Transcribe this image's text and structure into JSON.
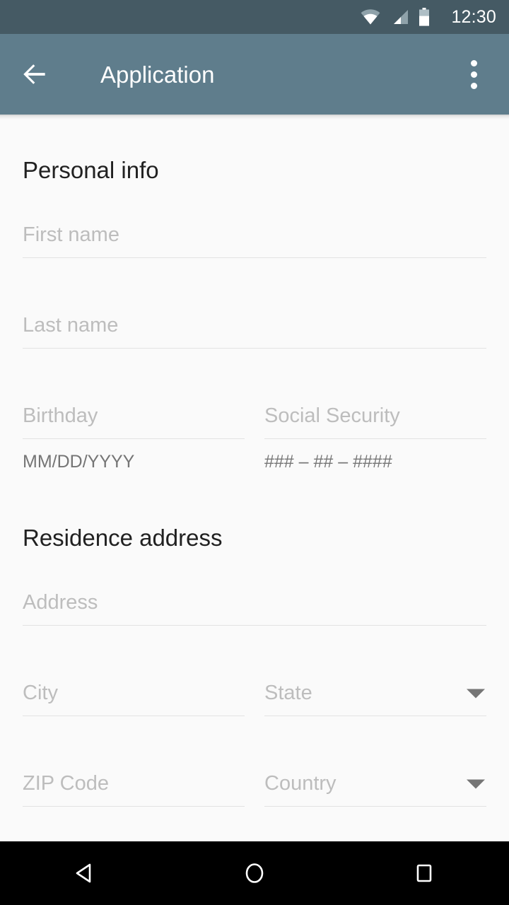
{
  "status_bar": {
    "clock": "12:30",
    "icons": [
      "wifi-icon",
      "cellular-signal-icon",
      "battery-icon"
    ],
    "background_color": "#455A64"
  },
  "app_bar": {
    "title": "Application",
    "back_icon": "arrow-left-icon",
    "overflow_icon": "more-vertical-icon",
    "background_color": "#5F7D8C",
    "text_color": "#FFFFFF"
  },
  "form": {
    "sections": [
      {
        "title": "Personal info"
      },
      {
        "title": "Residence address"
      }
    ],
    "fields": {
      "first_name": {
        "placeholder": "First name"
      },
      "last_name": {
        "placeholder": "Last name"
      },
      "birthday": {
        "placeholder": "Birthday",
        "helper": "MM/DD/YYYY"
      },
      "social_security": {
        "placeholder": "Social Security",
        "helper": "### – ## – ####"
      },
      "address": {
        "placeholder": "Address"
      },
      "city": {
        "placeholder": "City"
      },
      "state": {
        "placeholder": "State",
        "dropdown_icon": "chevron-down-icon"
      },
      "zip_code": {
        "placeholder": "ZIP Code"
      },
      "country": {
        "placeholder": "Country",
        "dropdown_icon": "chevron-down-icon"
      }
    },
    "colors": {
      "background": "#FAFAFA",
      "heading": "#212121",
      "placeholder": "#BDBDBD",
      "helper": "#757575",
      "underline": "#E3E3E3"
    }
  },
  "nav_bar": {
    "background_color": "#000000",
    "buttons": [
      {
        "name": "back",
        "icon": "triangle-back-icon"
      },
      {
        "name": "home",
        "icon": "circle-home-icon"
      },
      {
        "name": "recents",
        "icon": "square-recents-icon"
      }
    ]
  }
}
